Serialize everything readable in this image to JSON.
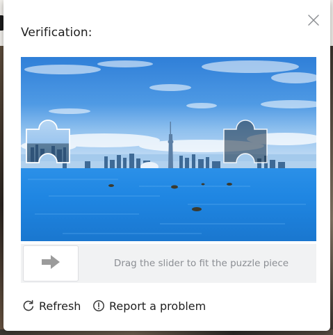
{
  "dialog": {
    "title": "Verification:",
    "close_icon": "close-icon"
  },
  "puzzle": {
    "image_description_icon": "city-skyline-puzzle-image",
    "piece_icon": "puzzle-piece-icon",
    "target_icon": "puzzle-target-slot-icon"
  },
  "slider": {
    "hint": "Drag the slider to fit the puzzle piece",
    "handle_icon": "arrow-right-icon",
    "progress": 0
  },
  "actions": {
    "refresh_label": "Refresh",
    "refresh_icon": "refresh-icon",
    "report_label": "Report a problem",
    "report_icon": "alert-circle-icon"
  },
  "colors": {
    "sky_top": "#2f7fd8",
    "water": "#1a8ae6",
    "slider_track": "#f1f2f3",
    "hint_text": "#8b8e93"
  }
}
